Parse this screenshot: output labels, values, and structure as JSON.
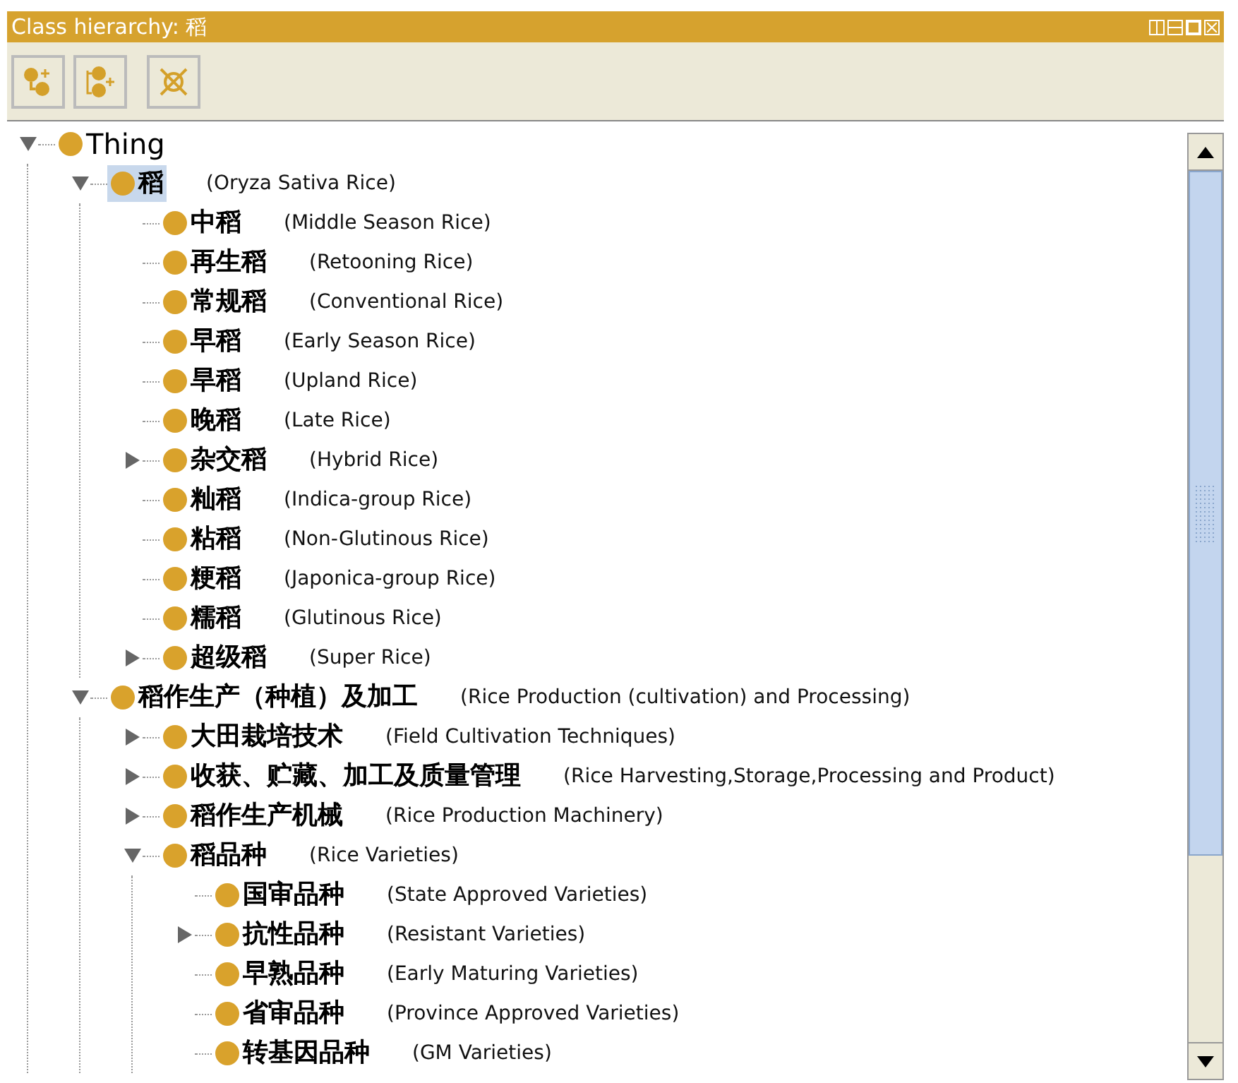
{
  "window": {
    "title": "Class hierarchy: 稻"
  },
  "toolbar": [
    {
      "kind": "add-subclass"
    },
    {
      "kind": "add-sibling"
    },
    {
      "kind": "delete"
    }
  ],
  "tree": [
    {
      "label": "Thing",
      "expanded": true,
      "selected": false,
      "children": [
        {
          "label": "稻",
          "note": "(Oryza Sativa Rice)",
          "expanded": true,
          "selected": true,
          "children": [
            {
              "label": "中稻",
              "note": "(Middle Season Rice)",
              "selected": false
            },
            {
              "label": "再生稻",
              "note": "(Retooning Rice)",
              "selected": false
            },
            {
              "label": "常规稻",
              "note": "(Conventional Rice)",
              "selected": false
            },
            {
              "label": "早稻",
              "note": "(Early Season Rice)",
              "selected": false
            },
            {
              "label": "旱稻",
              "note": "(Upland Rice)",
              "selected": false
            },
            {
              "label": "晚稻",
              "note": "(Late Rice)",
              "selected": false
            },
            {
              "label": "杂交稻",
              "note": "(Hybrid Rice)",
              "expanded": false,
              "selected": false
            },
            {
              "label": "籼稻",
              "note": "(Indica-group Rice)",
              "selected": false
            },
            {
              "label": "粘稻",
              "note": "(Non-Glutinous Rice)",
              "selected": false
            },
            {
              "label": "粳稻",
              "note": "(Japonica-group Rice)",
              "selected": false
            },
            {
              "label": "糯稻",
              "note": "(Glutinous Rice)",
              "selected": false
            },
            {
              "label": "超级稻",
              "note": "(Super Rice)",
              "expanded": false,
              "selected": false
            }
          ]
        },
        {
          "label": "稻作生产（种植）及加工",
          "note": "(Rice Production (cultivation) and Processing)",
          "expanded": true,
          "selected": false,
          "children": [
            {
              "label": "大田栽培技术",
              "note": "(Field Cultivation Techniques)",
              "expanded": false,
              "selected": false
            },
            {
              "label": "收获、贮藏、加工及质量管理",
              "note": "(Rice Harvesting,Storage,Processing and Product)",
              "expanded": false,
              "selected": false
            },
            {
              "label": "稻作生产机械",
              "note": "(Rice Production Machinery)",
              "expanded": false,
              "selected": false
            },
            {
              "label": "稻品种",
              "note": "(Rice Varieties)",
              "expanded": true,
              "selected": false,
              "children": [
                {
                  "label": "国审品种",
                  "note": "(State Approved Varieties)",
                  "selected": false
                },
                {
                  "label": "抗性品种",
                  "note": "(Resistant Varieties)",
                  "expanded": false,
                  "selected": false
                },
                {
                  "label": "早熟品种",
                  "note": "(Early Maturing Varieties)",
                  "selected": false
                },
                {
                  "label": "省审品种",
                  "note": "(Province Approved Varieties)",
                  "selected": false
                },
                {
                  "label": "转基因品种",
                  "note": "(GM Varieties)",
                  "selected": false
                }
              ]
            }
          ]
        }
      ]
    }
  ]
}
